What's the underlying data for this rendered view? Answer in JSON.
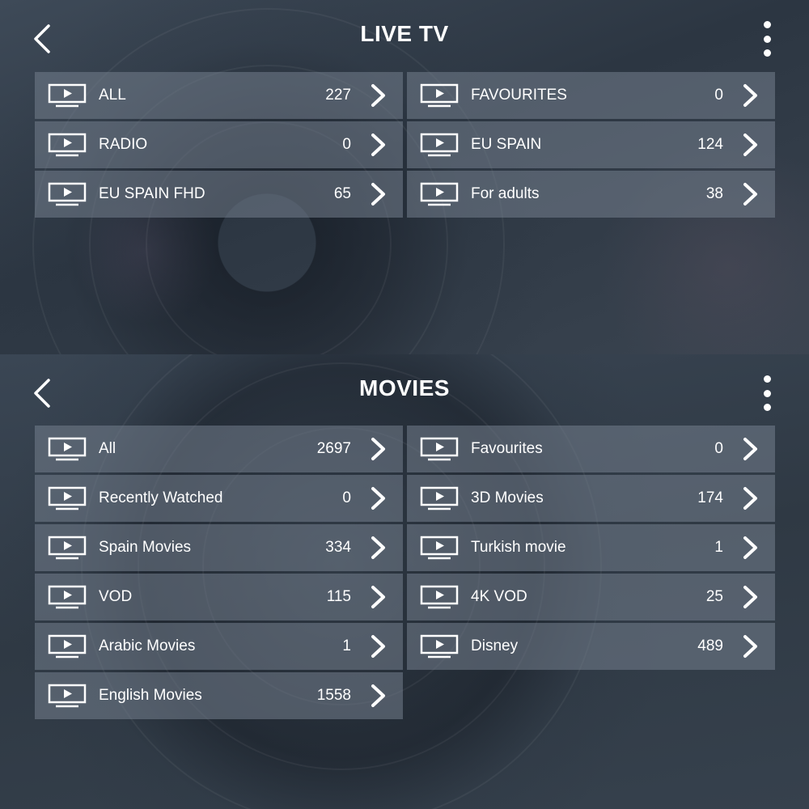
{
  "live_tv": {
    "title": "LIVE TV",
    "categories": [
      {
        "label": "ALL",
        "count": "227"
      },
      {
        "label": "FAVOURITES",
        "count": "0"
      },
      {
        "label": "RADIO",
        "count": "0"
      },
      {
        "label": "EU SPAIN",
        "count": "124"
      },
      {
        "label": "EU SPAIN FHD",
        "count": "65"
      },
      {
        "label": "For adults",
        "count": "38"
      }
    ]
  },
  "movies": {
    "title": "MOVIES",
    "categories": [
      {
        "label": "All",
        "count": "2697"
      },
      {
        "label": "Favourites",
        "count": "0"
      },
      {
        "label": "Recently Watched",
        "count": "0"
      },
      {
        "label": "3D Movies",
        "count": "174"
      },
      {
        "label": "Spain Movies",
        "count": "334"
      },
      {
        "label": "Turkish movie",
        "count": "1"
      },
      {
        "label": "VOD",
        "count": "115"
      },
      {
        "label": "4K VOD",
        "count": "25"
      },
      {
        "label": "Arabic Movies",
        "count": "1"
      },
      {
        "label": "Disney",
        "count": "489"
      },
      {
        "label": "English Movies",
        "count": "1558"
      }
    ]
  },
  "icons": {
    "back": "chevron-left-icon",
    "menu": "more-vertical-icon",
    "category": "tv-play-icon",
    "row_arrow": "chevron-right-icon"
  },
  "colors": {
    "text": "#ffffff",
    "row_background": "#74808e"
  }
}
